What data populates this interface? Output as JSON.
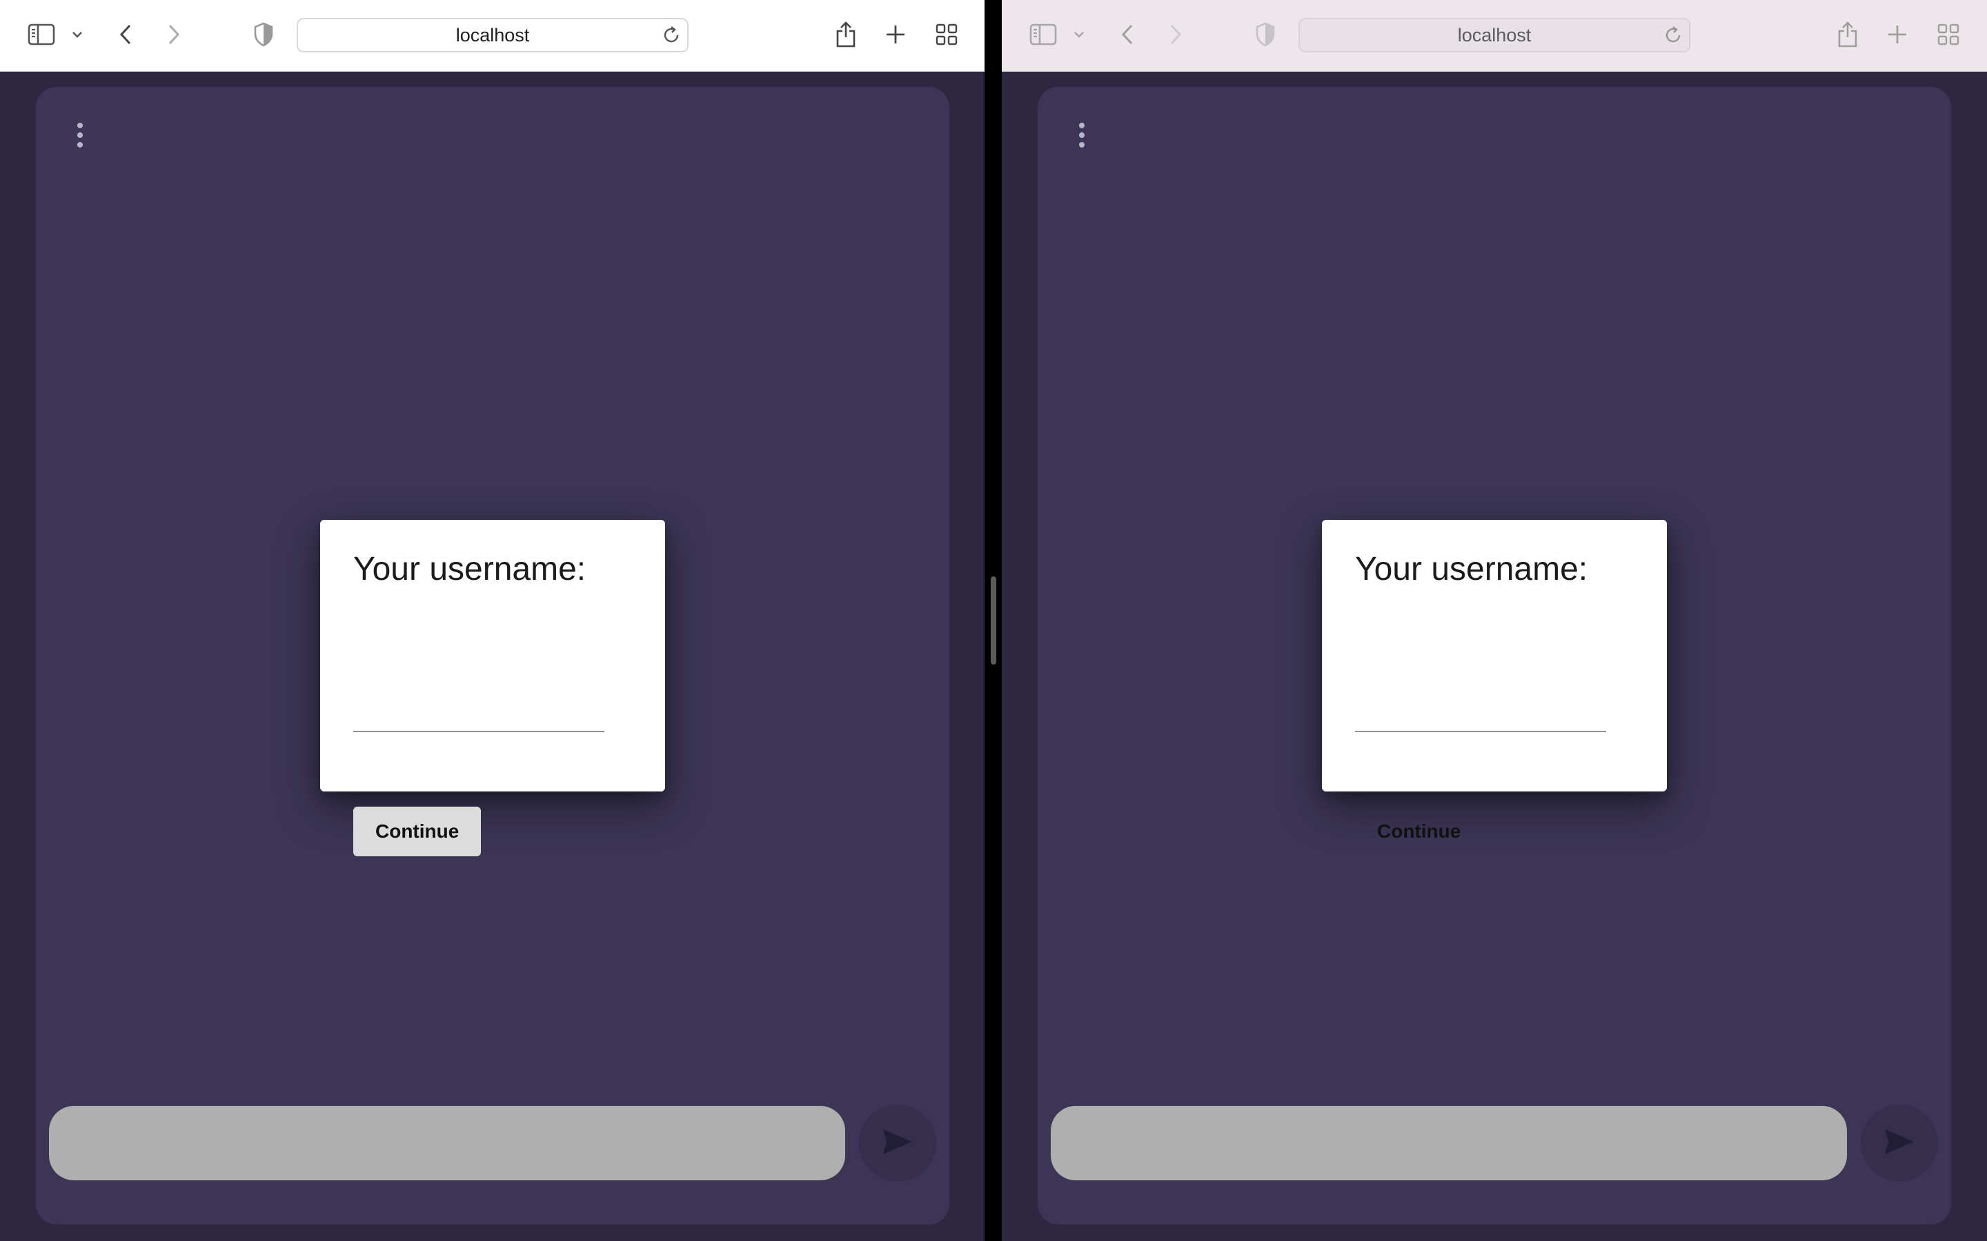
{
  "windows": [
    {
      "id": "left",
      "url": "localhost",
      "dialog": {
        "title": "Your username:",
        "username_value": "",
        "continue_label": "Continue"
      },
      "message_input_value": ""
    },
    {
      "id": "right",
      "url": "localhost",
      "dialog": {
        "title": "Your username:",
        "username_value": "",
        "continue_label": "Continue"
      },
      "message_input_value": ""
    }
  ],
  "icons": {
    "sidebar": "sidebar-icon",
    "tab_group_menu": "chevron-down-icon",
    "back": "chevron-left-icon",
    "forward": "chevron-right-icon",
    "privacy": "shield-icon",
    "reload": "reload-icon",
    "share": "share-icon",
    "new_tab": "plus-icon",
    "tab_overview": "grid-icon",
    "menu": "kebab-menu-icon",
    "send": "send-icon"
  },
  "colors": {
    "page_background": "#2d2742",
    "app_card": "#3c3556",
    "message_input": "#afafaf",
    "send_button": "#352f4d",
    "dialog": "#ffffff",
    "continue_button_active": "#dcdcdc",
    "toolbar_active": "#ffffff",
    "toolbar_inactive": "#ede7ec"
  }
}
